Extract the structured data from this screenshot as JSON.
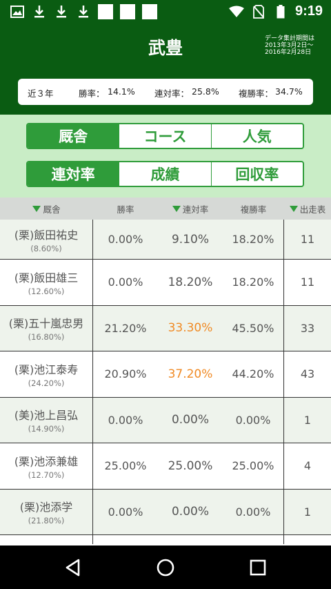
{
  "status_bar": {
    "time": "9:19",
    "left_icons": [
      "image-icon",
      "download-icon",
      "download-icon",
      "download-icon",
      "blank-square",
      "blank-square",
      "blank-square"
    ],
    "right_icons": [
      "wifi-icon",
      "no-sim-icon",
      "battery-icon"
    ]
  },
  "header": {
    "title": "武豊",
    "period_line1": "データ集計期間は",
    "period_line2": "2013年3月2日～",
    "period_line3": "2016年2月28日"
  },
  "summary": {
    "period": "近３年",
    "win_label": "勝率：",
    "win_value": "14.1%",
    "quinella_label": "連対率：",
    "quinella_value": "25.8%",
    "show_label": "複勝率：",
    "show_value": "34.7%"
  },
  "tabs_row1": [
    {
      "label": "厩舎",
      "active": true
    },
    {
      "label": "コース",
      "active": false
    },
    {
      "label": "人気",
      "active": false
    }
  ],
  "tabs_row2": [
    {
      "label": "連対率",
      "active": true
    },
    {
      "label": "成績",
      "active": false
    },
    {
      "label": "回収率",
      "active": false
    }
  ],
  "table": {
    "headers": [
      "厩舎",
      "勝率",
      "連対率",
      "複勝率",
      "出走表"
    ],
    "rows": [
      {
        "name": "(栗)飯田祐史",
        "pct": "(8.60%)",
        "win": "0.00%",
        "quinella": "9.10%",
        "show": "18.20%",
        "runs": "11",
        "highlight": false
      },
      {
        "name": "(栗)飯田雄三",
        "pct": "(12.60%)",
        "win": "0.00%",
        "quinella": "18.20%",
        "show": "18.20%",
        "runs": "11",
        "highlight": false
      },
      {
        "name": "(栗)五十嵐忠男",
        "pct": "(16.80%)",
        "win": "21.20%",
        "quinella": "33.30%",
        "show": "45.50%",
        "runs": "33",
        "highlight": true
      },
      {
        "name": "(栗)池江泰寿",
        "pct": "(24.20%)",
        "win": "20.90%",
        "quinella": "37.20%",
        "show": "44.20%",
        "runs": "43",
        "highlight": true
      },
      {
        "name": "(美)池上昌弘",
        "pct": "(14.90%)",
        "win": "0.00%",
        "quinella": "0.00%",
        "show": "0.00%",
        "runs": "1",
        "highlight": false
      },
      {
        "name": "(栗)池添兼雄",
        "pct": "(12.70%)",
        "win": "25.00%",
        "quinella": "25.00%",
        "show": "25.00%",
        "runs": "4",
        "highlight": false
      },
      {
        "name": "(栗)池添学",
        "pct": "(21.80%)",
        "win": "0.00%",
        "quinella": "0.00%",
        "show": "0.00%",
        "runs": "1",
        "highlight": false
      }
    ]
  },
  "colors": {
    "header_bg": "#0a5c12",
    "accent": "#2f9c3a",
    "tab_zone_bg": "#c9edc6",
    "highlight": "#f08a24"
  },
  "nav_bar": [
    "back-icon",
    "home-icon",
    "recents-icon"
  ]
}
